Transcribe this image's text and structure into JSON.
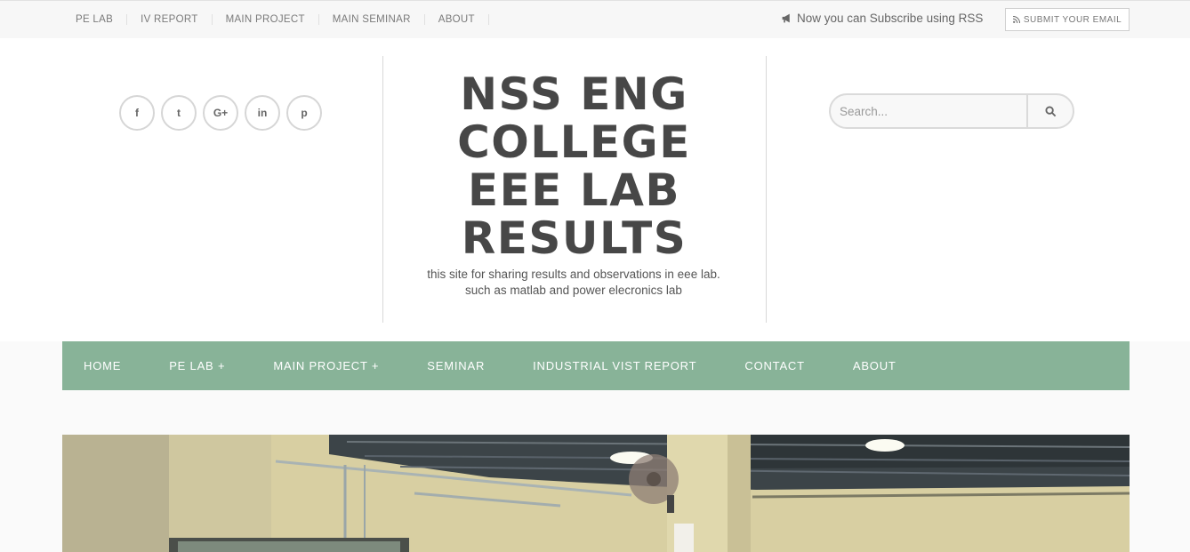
{
  "topbar": {
    "links": [
      "PE LAB",
      "IV REPORT",
      "MAIN PROJECT",
      "MAIN SEMINAR",
      "ABOUT"
    ],
    "rss_text": "Now you can Subscribe using RSS",
    "rss_icon": "bullhorn-icon",
    "submit_label": "SUBMIT YOUR EMAIL",
    "submit_icon": "rss-icon"
  },
  "header": {
    "social": [
      {
        "icon": "facebook-icon",
        "glyph": "f"
      },
      {
        "icon": "twitter-icon",
        "glyph": "t"
      },
      {
        "icon": "google-plus-icon",
        "glyph": "G+"
      },
      {
        "icon": "linkedin-icon",
        "glyph": "in"
      },
      {
        "icon": "pinterest-icon",
        "glyph": "p"
      }
    ],
    "title": "NSS ENG COLLEGE EEE LAB RESULTS",
    "tagline": "this site for sharing results and observations in eee lab. such as matlab and power elecronics lab",
    "search_placeholder": "Search..."
  },
  "mainnav": {
    "items": [
      "HOME",
      "PE LAB +",
      "MAIN PROJECT +",
      "SEMINAR",
      "INDUSTRIAL VIST REPORT",
      "CONTACT",
      "ABOUT"
    ]
  },
  "colors": {
    "nav_bg": "#88b398",
    "title": "#474747"
  }
}
